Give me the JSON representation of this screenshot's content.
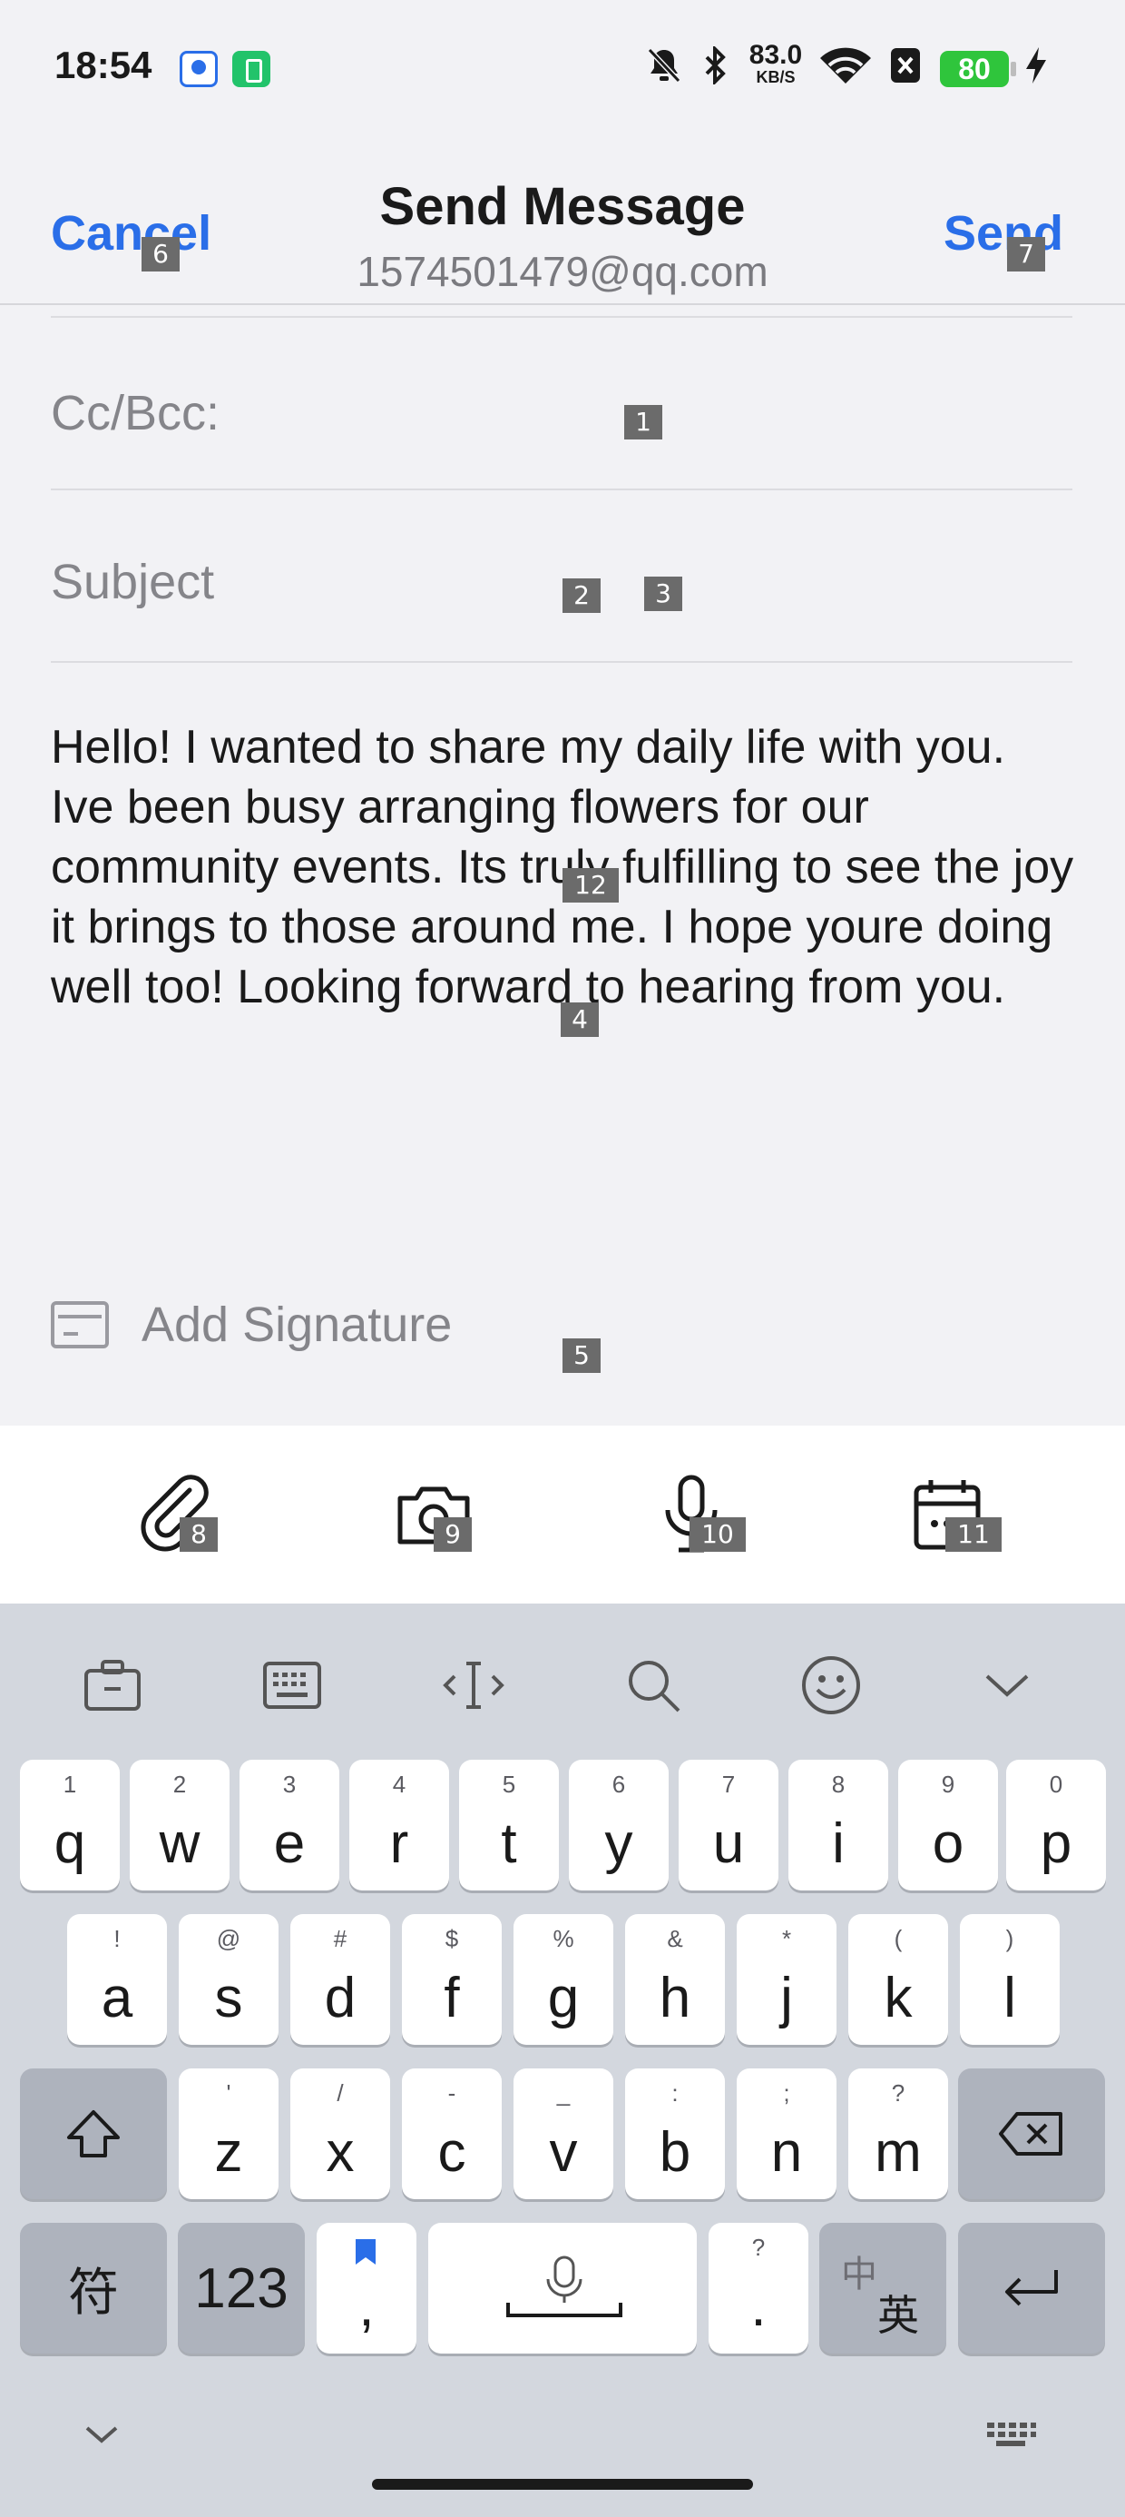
{
  "status_bar": {
    "time": "18:54",
    "net_speed_value": "83.0",
    "net_speed_unit": "KB/S",
    "battery_level": "80"
  },
  "header": {
    "cancel_label": "Cancel",
    "title": "Send Message",
    "from_email": "1574501479@qq.com",
    "send_label": "Send"
  },
  "form": {
    "cc_bcc_placeholder": "Cc/Bcc:",
    "subject_placeholder": "Subject",
    "body": "Hello! I wanted to share my daily life with you. Ive been busy arranging flowers for our community events. Its truly fulfilling to see the joy it brings to those around me. I hope youre doing well too! Looking forward to hearing from you.",
    "signature_label": "Add Signature"
  },
  "toolbar": {
    "icons": [
      "paperclip-icon",
      "camera-icon",
      "microphone-icon",
      "calendar-icon"
    ]
  },
  "keyboard": {
    "toolbar_icons": [
      "clipboard-icon",
      "keyboard-layout-icon",
      "cursor-icon",
      "search-icon",
      "emoji-icon",
      "chevron-down-icon"
    ],
    "row1": [
      {
        "key": "q",
        "hint": "1"
      },
      {
        "key": "w",
        "hint": "2"
      },
      {
        "key": "e",
        "hint": "3"
      },
      {
        "key": "r",
        "hint": "4"
      },
      {
        "key": "t",
        "hint": "5"
      },
      {
        "key": "y",
        "hint": "6"
      },
      {
        "key": "u",
        "hint": "7"
      },
      {
        "key": "i",
        "hint": "8"
      },
      {
        "key": "o",
        "hint": "9"
      },
      {
        "key": "p",
        "hint": "0"
      }
    ],
    "row2": [
      {
        "key": "a",
        "hint": "!"
      },
      {
        "key": "s",
        "hint": "@"
      },
      {
        "key": "d",
        "hint": "#"
      },
      {
        "key": "f",
        "hint": "$"
      },
      {
        "key": "g",
        "hint": "%"
      },
      {
        "key": "h",
        "hint": "&"
      },
      {
        "key": "j",
        "hint": "*"
      },
      {
        "key": "k",
        "hint": "("
      },
      {
        "key": "l",
        "hint": ")"
      }
    ],
    "row3": [
      {
        "key": "z",
        "hint": "'"
      },
      {
        "key": "x",
        "hint": "/"
      },
      {
        "key": "c",
        "hint": "-"
      },
      {
        "key": "v",
        "hint": "_"
      },
      {
        "key": "b",
        "hint": ":"
      },
      {
        "key": "n",
        "hint": ";"
      },
      {
        "key": "m",
        "hint": "?"
      }
    ],
    "symbol_key": "符",
    "numbers_key": "123",
    "comma_key": ",",
    "period_key": ".",
    "period_hint": "?",
    "lang_key_top": "中",
    "lang_key_bottom": "英"
  },
  "markers": {
    "m1": "1",
    "m2": "2",
    "m3": "3",
    "m4": "4",
    "m5": "5",
    "m6": "6",
    "m7": "7",
    "m8": "8",
    "m9": "9",
    "m10": "10",
    "m11": "11",
    "m12": "12"
  },
  "colors": {
    "accent": "#2a6ee8",
    "background": "#f2f2f5",
    "keyboard_bg": "#d3d7de",
    "battery": "#2fc53c"
  }
}
